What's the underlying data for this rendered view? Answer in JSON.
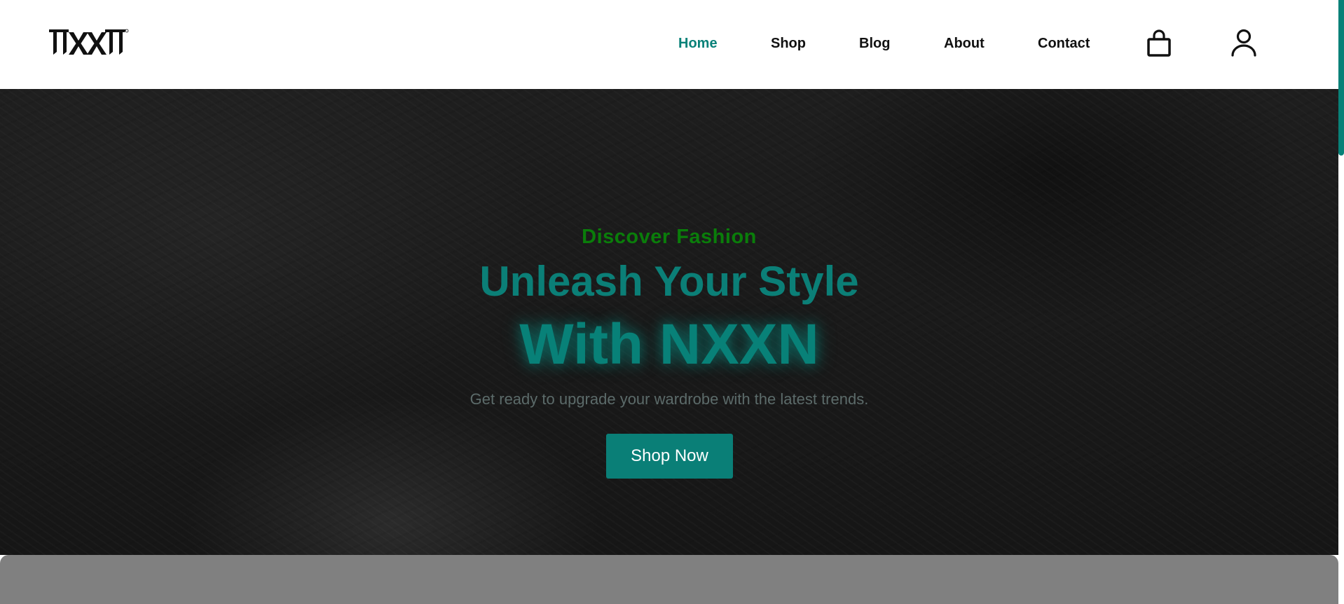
{
  "brand": {
    "logo_text": "NXXN"
  },
  "nav": {
    "items": [
      {
        "label": "Home",
        "active": true
      },
      {
        "label": "Shop",
        "active": false
      },
      {
        "label": "Blog",
        "active": false
      },
      {
        "label": "About",
        "active": false
      },
      {
        "label": "Contact",
        "active": false
      }
    ],
    "icons": [
      "shopping-bag-icon",
      "user-icon"
    ]
  },
  "hero": {
    "eyebrow": "Discover Fashion",
    "title_line1": "Unleash Your Style",
    "title_line2": "With NXXN",
    "subtitle": "Get ready to upgrade your wardrobe with the latest trends.",
    "cta_label": "Shop Now"
  },
  "colors": {
    "accent": "#088178",
    "eyebrow": "#0a7d0a",
    "nav_text": "#111111",
    "hero_bg": "#1a1a1a",
    "panel_gray": "#808080"
  }
}
